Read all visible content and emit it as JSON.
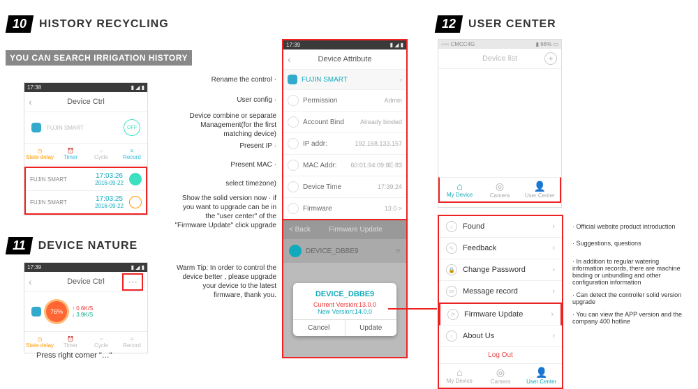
{
  "sections": {
    "s10": {
      "num": "10",
      "title": "HISTORY RECYCLING",
      "banner": "YOU CAN SEARCH IRRIGATION HISTORY"
    },
    "s11": {
      "num": "11",
      "title": "DEVICE NATURE",
      "caption": "Press right corner  \"…\""
    },
    "s12": {
      "num": "12",
      "title": "USER CENTER"
    }
  },
  "history_phone": {
    "time": "17:38",
    "header": "Device Ctrl",
    "device": "FUJIN SMART",
    "off": "OFF",
    "tabs": [
      "State delay",
      "Timer",
      "Cycle",
      "Record"
    ],
    "rows": [
      {
        "name": "FUJIN SMART",
        "time": "17:03:26",
        "date": "2016-09-22",
        "state": "on"
      },
      {
        "name": "FUJIN SMART",
        "time": "17:03:25",
        "date": "2016-09-22",
        "state": "off"
      }
    ]
  },
  "nature_phone": {
    "time": "17:39",
    "header": "Device Ctrl",
    "gauge": "76%",
    "rate1": "0.6K/S",
    "rate2": "3.9K/S",
    "tabs": [
      "State delay",
      "Timer",
      "Cycle",
      "Record"
    ]
  },
  "attr_labels": {
    "rename": "Rename the control ·",
    "user": "User config ·",
    "combine": "Device combine or separate",
    "mgmt": "Management(for the first matching device)",
    "ip": "Present IP ·",
    "mac": "Present MAC ·",
    "tz": "select timezone)",
    "fw": "Show the solid version now · if you want to upgrade can be in the \"user center\" of the \"Firmware Update\" click upgrade"
  },
  "attr_phone": {
    "time": "17:39",
    "header": "Device Attribute",
    "device": "FUJIN SMART",
    "rows": [
      {
        "label": "Permission",
        "val": "Admin"
      },
      {
        "label": "Account Bind",
        "val": "Already binded"
      },
      {
        "label": "IP addr:",
        "val": "192.168.133.157"
      },
      {
        "label": "MAC Addr:",
        "val": "60:01:94:09:8E:83"
      },
      {
        "label": "Device Time",
        "val": "17:39:24"
      },
      {
        "label": "Firmware",
        "val": "13.0 >"
      }
    ]
  },
  "warm_tip": "Warm Tip: In order to control the device better , please upgrade your device to the latest firmware, thank you.",
  "fw_phone": {
    "back": "< Back",
    "header": "Firmware Update",
    "device": "DEVICE_DBBE9",
    "curr": "Current Version:13.0.0",
    "new": "New Version:14.0.0",
    "cancel": "Cancel",
    "update": "Update"
  },
  "devlist_phone": {
    "carrier": "CMCC4G",
    "batt": "66%",
    "header": "Device list",
    "tabs": {
      "my": "My Device",
      "cam": "Camera",
      "uc": "User Center"
    }
  },
  "uc_phone": {
    "items": [
      "Found",
      "Feedback",
      "Change Password",
      "Message record",
      "Firmware Update",
      "About Us"
    ],
    "logout": "Log Out",
    "tabs": {
      "my": "My Device",
      "cam": "Camera",
      "uc": "User Center"
    }
  },
  "uc_notes": {
    "found": "Official website product introduction",
    "feedback": "Suggestions, questions",
    "msg": "In addition to regular watering information records, there are machine binding or unbundling and other configuration information",
    "fw": "Can detect the controller solid version upgrade",
    "about": "You can view the APP version and the company 400 hotline"
  }
}
